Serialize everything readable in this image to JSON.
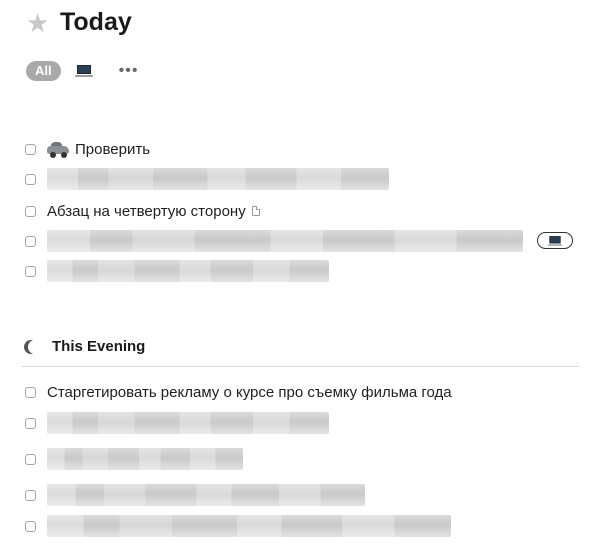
{
  "header": {
    "title": "Today",
    "icon": "star-icon"
  },
  "filters": {
    "all_label": "All",
    "device_icon": "laptop-icon",
    "more_icon": "more-icon"
  },
  "today_items": [
    {
      "type": "text",
      "emoji": "car-icon",
      "text": "Проверить"
    },
    {
      "type": "blurred"
    },
    {
      "type": "text",
      "text": "Абзац на четвертую сторону",
      "note_icon": "note-icon"
    },
    {
      "type": "blurred",
      "tag_icon": "laptop-icon"
    },
    {
      "type": "blurred"
    }
  ],
  "evening": {
    "title": "This Evening",
    "icon": "moon-icon",
    "items": [
      {
        "type": "text",
        "text": "Старгетировать рекламу о курсе про съемку фильма года"
      },
      {
        "type": "blurred"
      },
      {
        "type": "blurred"
      },
      {
        "type": "blurred"
      },
      {
        "type": "blurred"
      }
    ]
  }
}
